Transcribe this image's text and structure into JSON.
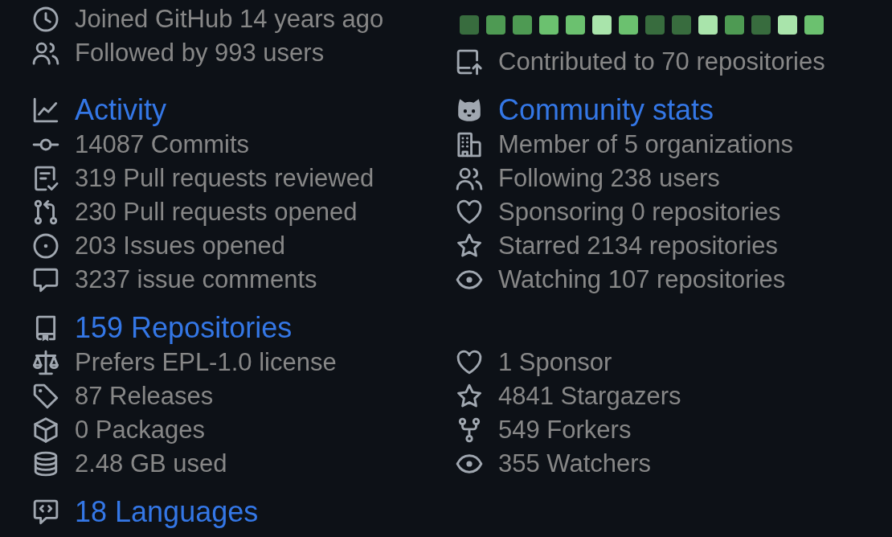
{
  "profile": {
    "items": [
      {
        "kind": "joined",
        "text": "Joined GitHub 14 years ago"
      },
      {
        "kind": "followers",
        "text": "Followed by 993 users"
      }
    ]
  },
  "contributions": {
    "days": [
      {
        "color": "#386c3e"
      },
      {
        "color": "#4e9a53"
      },
      {
        "color": "#4e9a53"
      },
      {
        "color": "#6bc16f"
      },
      {
        "color": "#6bc16f"
      },
      {
        "color": "#a9e4ab"
      },
      {
        "color": "#6bc16f"
      },
      {
        "color": "#386c3e"
      },
      {
        "color": "#386c3e"
      },
      {
        "color": "#a9e4ab"
      },
      {
        "color": "#4e9a53"
      },
      {
        "color": "#386c3e"
      },
      {
        "color": "#a9e4ab"
      },
      {
        "color": "#6bc16f"
      }
    ],
    "items": [
      {
        "kind": "contributed",
        "text": "Contributed to 70 repositories"
      }
    ]
  },
  "activity": {
    "kind": "activity",
    "title": "Activity",
    "items": [
      {
        "kind": "commits",
        "text": "14087 Commits"
      },
      {
        "kind": "reviewed",
        "text": "319 Pull requests reviewed"
      },
      {
        "kind": "pulls",
        "text": "230 Pull requests opened"
      },
      {
        "kind": "issues",
        "text": "203 Issues opened"
      },
      {
        "kind": "comments",
        "text": "3237 issue comments"
      }
    ]
  },
  "community": {
    "kind": "community",
    "title": "Community stats",
    "items": [
      {
        "kind": "organizations",
        "text": "Member of 5 organizations"
      },
      {
        "kind": "following",
        "text": "Following 238 users"
      },
      {
        "kind": "sponsoring",
        "text": "Sponsoring 0 repositories"
      },
      {
        "kind": "starred",
        "text": "Starred 2134 repositories"
      },
      {
        "kind": "watching",
        "text": "Watching 107 repositories"
      }
    ]
  },
  "repositories": {
    "kind": "repositories",
    "title": "159 Repositories",
    "items": [
      {
        "kind": "license",
        "text": "Prefers EPL-1.0 license"
      },
      {
        "kind": "releases",
        "text": "87 Releases"
      },
      {
        "kind": "packages",
        "text": "0 Packages"
      },
      {
        "kind": "storage",
        "text": "2.48 GB used"
      }
    ]
  },
  "repository_stats": {
    "items": [
      {
        "kind": "sponsors",
        "text": "1 Sponsor"
      },
      {
        "kind": "stargazers",
        "text": "4841 Stargazers"
      },
      {
        "kind": "forkers",
        "text": "549 Forkers"
      },
      {
        "kind": "watchers",
        "text": "355 Watchers"
      }
    ]
  },
  "languages": {
    "kind": "languages",
    "title": "18 Languages"
  }
}
